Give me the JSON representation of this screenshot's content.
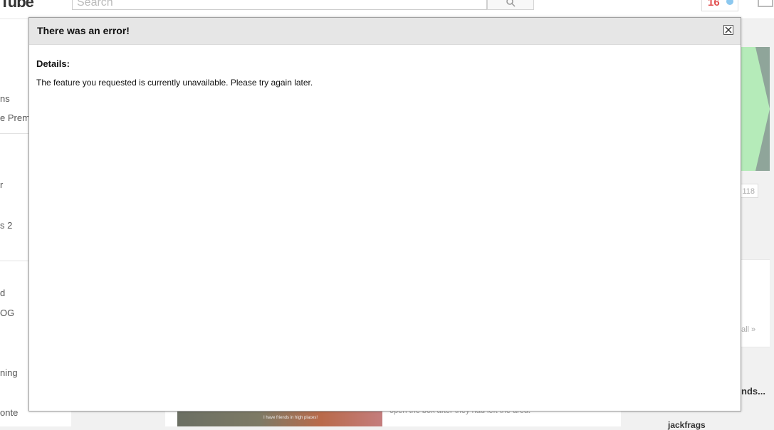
{
  "app": {
    "logo_text": "Tube"
  },
  "header": {
    "search_placeholder": "Search",
    "search_icon": "search-icon",
    "notification_count": "16",
    "upload_icon": "upload-icon"
  },
  "sidebar": {
    "items": [
      {
        "label": "ns"
      },
      {
        "label": "e Prem"
      },
      {
        "label": "r"
      },
      {
        "label": "s 2"
      },
      {
        "label": "d"
      },
      {
        "label": "OG"
      },
      {
        "label": "ning"
      },
      {
        "label": "onte"
      }
    ]
  },
  "feed": {
    "thumbnail_caption": "I have friends in high places!",
    "description": "open the box after they had left the area.",
    "more_icon": "more-icon"
  },
  "right": {
    "promo_count": "118",
    "see_all": "all »",
    "trend_title": "nds...",
    "channel_name": "jackfrags"
  },
  "modal": {
    "title": "There was an error!",
    "close_icon": "close-icon",
    "details_label": "Details:",
    "message": "The feature you requested is currently unavailable. Please try again later."
  },
  "colors": {
    "modal_header_bg": "#e6e6e6",
    "notification_red": "#e25252",
    "promo_green": "#b5ebb9"
  }
}
